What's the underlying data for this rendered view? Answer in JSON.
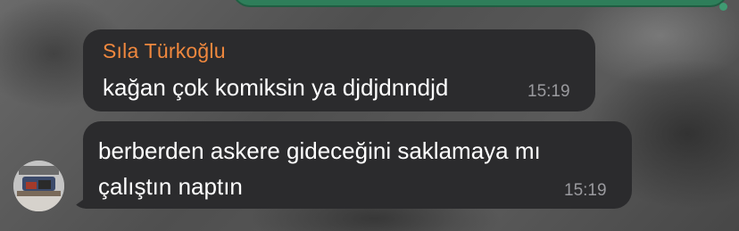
{
  "chat": {
    "messages": [
      {
        "sender": "Sıla Türkoğlu",
        "text": "kağan çok komiksin ya djdjdnndjd",
        "time": "15:19"
      },
      {
        "text": "berberden askere gideceğini saklamaya mı çalıştın naptın",
        "time": "15:19"
      }
    ]
  },
  "colors": {
    "bubble_background": "#2b2b2d",
    "sender_name": "#f0883e",
    "timestamp": "#9a9a9e",
    "sent_bubble": "#2e7e5a"
  }
}
